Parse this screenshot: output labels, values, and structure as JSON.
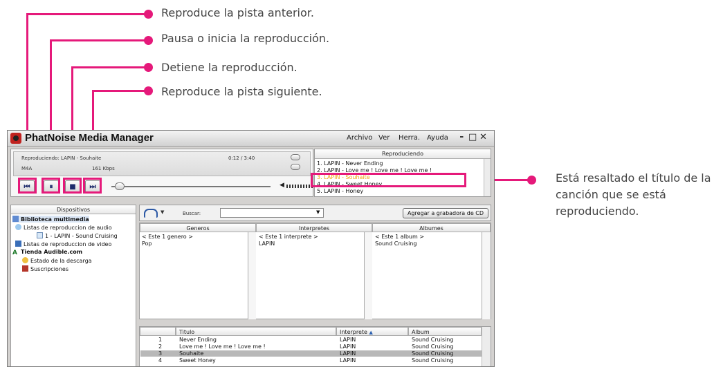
{
  "annotations": {
    "previous": "Reproduce la pista anterior.",
    "play_pause": "Pausa o inicia la reproducción.",
    "stop": "Detiene la reproducción.",
    "next": "Reproduce la pista siguiente.",
    "highlight": "Está resaltado el título de la canción que se está reproduciendo."
  },
  "colors": {
    "callout": "#e5197a",
    "playing_text": "#f0a410"
  },
  "window": {
    "title": "PhatNoise Media Manager",
    "menu": [
      "Archivo",
      "Ver",
      "Herra.",
      "Ayuda"
    ],
    "controls": {
      "minimize": "‗",
      "maximize": "□",
      "close": "✕"
    }
  },
  "player": {
    "now_playing_text": "Reproduciendo: LAPIN - Souhaite",
    "time": "0:12 / 3:40",
    "format": "M4A",
    "bitrate": "161 Kbps",
    "buttons": {
      "previous": "⏮",
      "pause": "⏸",
      "stop": "■",
      "next": "⏭"
    }
  },
  "now_playing_panel": {
    "header": "Reproduciendo",
    "items": [
      "1. LAPIN - Never Ending",
      "2. LAPIN - Love me ! Love me ! Love me !",
      "3. LAPIN - Souhaite",
      "4. LAPIN - Sweet Honey",
      "5. LAPIN - Honey"
    ]
  },
  "devices": {
    "header": "Dispositivos",
    "tree": [
      "Biblioteca multimedia",
      "Listas de reproduccion de audio",
      "1 - LAPIN - Sound Cruising",
      "Listas de reproduccion de video",
      "Tienda Audible.com",
      "Estado de la descarga",
      "Suscripciones"
    ]
  },
  "toolbar": {
    "search_label": "Buscar:",
    "search_value": "",
    "cd_button": "Agregar a grabadora de CD"
  },
  "browse": {
    "headers": [
      "Generos",
      "Interpretes",
      "Albumes"
    ],
    "columns": [
      [
        "< Este 1 genero >",
        "Pop"
      ],
      [
        "< Este 1 interprete >",
        "LAPIN"
      ],
      [
        "< Este 1 album >",
        "Sound Cruising"
      ]
    ]
  },
  "tracklist": {
    "headers": [
      "Titulo",
      "Interprete",
      "Album"
    ],
    "sort_indicator": "▲",
    "rows": [
      [
        "1",
        "Never Ending",
        "LAPIN",
        "Sound Cruising"
      ],
      [
        "2",
        "Love me ! Love me ! Love me !",
        "LAPIN",
        "Sound Cruising"
      ],
      [
        "3",
        "Souhaite",
        "LAPIN",
        "Sound Cruising"
      ],
      [
        "4",
        "Sweet Honey",
        "LAPIN",
        "Sound Cruising"
      ]
    ]
  }
}
